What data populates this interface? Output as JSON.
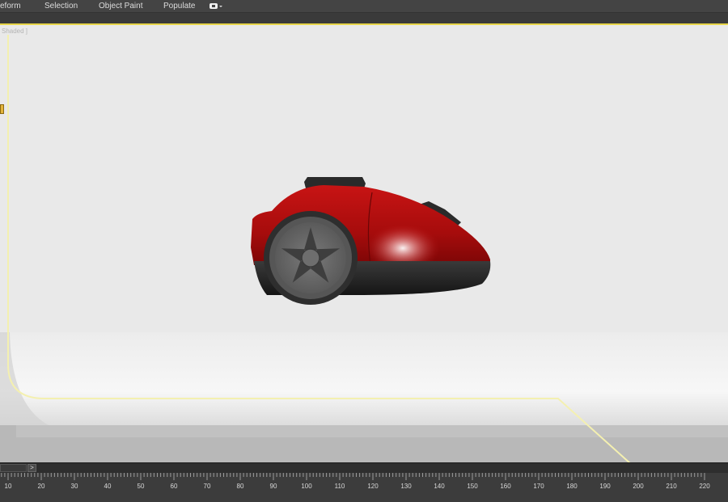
{
  "menubar": {
    "items": [
      {
        "id": "freeform",
        "label": "eform"
      },
      {
        "id": "selection",
        "label": "Selection"
      },
      {
        "id": "object-paint",
        "label": "Object Paint"
      },
      {
        "id": "populate",
        "label": "Populate"
      }
    ],
    "toggle_icon": "visibility-toggle-icon"
  },
  "viewport": {
    "label": "Shaded ]",
    "active_border_color": "#e8d64a",
    "object": "vacuum-cleaner-model",
    "body_color": "#b01010"
  },
  "timeline": {
    "next_button_label": ">",
    "ruler_labels": [
      "10",
      "20",
      "30",
      "40",
      "50",
      "60",
      "70",
      "80",
      "90",
      "100",
      "110",
      "120",
      "130",
      "140",
      "150",
      "160",
      "170",
      "180",
      "190",
      "200",
      "210",
      "220"
    ]
  }
}
